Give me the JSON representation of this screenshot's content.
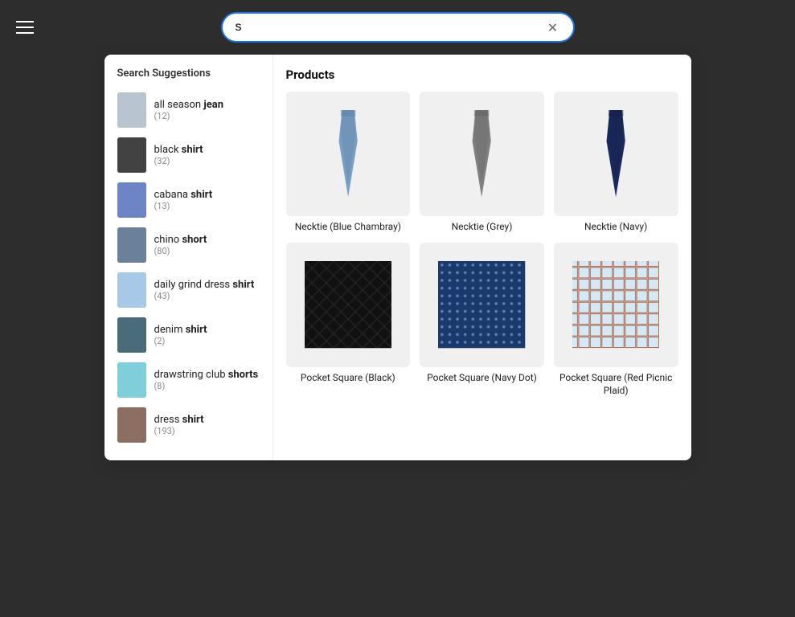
{
  "header": {
    "menu_aria": "menu",
    "search_value": "s",
    "clear_aria": "clear search"
  },
  "suggestions": {
    "heading": "Search Suggestions",
    "items": [
      {
        "id": "all-season-jean",
        "name_prefix": "all season ",
        "name_bold": "jean",
        "count": 12,
        "thumb_color": "#b8c5d0",
        "label": "all season jean"
      },
      {
        "id": "black-shirt",
        "name_prefix": "black ",
        "name_bold": "shirt",
        "count": 32,
        "thumb_color": "#424242",
        "label": "black shirt"
      },
      {
        "id": "cabana-shirt",
        "name_prefix": "cabana ",
        "name_bold": "shirt",
        "count": 13,
        "thumb_color": "#6d85c4",
        "label": "cabana shirt"
      },
      {
        "id": "chino-short",
        "name_prefix": "chino ",
        "name_bold": "short",
        "count": 80,
        "thumb_color": "#6b8099",
        "label": "chino short"
      },
      {
        "id": "daily-grind-dress-shirt",
        "name_prefix": "daily grind dress ",
        "name_bold": "shirt",
        "count": 43,
        "thumb_color": "#a8c8e8",
        "label": "daily grind dress shirt"
      },
      {
        "id": "denim-shirt",
        "name_prefix": "denim ",
        "name_bold": "shirt",
        "count": 2,
        "thumb_color": "#4a6b7a",
        "label": "denim shirt"
      },
      {
        "id": "drawstring-club-shorts",
        "name_prefix": "drawstring club ",
        "name_bold": "shorts",
        "count": 8,
        "thumb_color": "#7ecfd9",
        "label": "drawstring club shorts"
      },
      {
        "id": "dress-shirt",
        "name_prefix": "dress ",
        "name_bold": "shirt",
        "count": 193,
        "thumb_color": "#8d6e63",
        "label": "dress shirt"
      }
    ]
  },
  "products": {
    "heading": "Products",
    "items": [
      {
        "id": "necktie-blue-chambray",
        "name": "Necktie (Blue Chambray)",
        "image_type": "necktie-blue",
        "color_main": "#7b9fc4",
        "color_detail": "#5a7fa0"
      },
      {
        "id": "necktie-grey",
        "name": "Necktie (Grey)",
        "image_type": "necktie-grey",
        "color_main": "#808080",
        "color_detail": "#606060"
      },
      {
        "id": "necktie-navy",
        "name": "Necktie (Navy)",
        "image_type": "necktie-navy",
        "color_main": "#1a2a5e",
        "color_detail": "#131e42"
      },
      {
        "id": "pocket-square-black",
        "name": "Pocket Square (Black)",
        "image_type": "pocket-square-black",
        "color_main": "#1a1a1a",
        "color_detail": "#333333"
      },
      {
        "id": "pocket-square-navy-dot",
        "name": "Pocket Square (Navy Dot)",
        "image_type": "pocket-square-navy-dot",
        "color_main": "#1a3a6e",
        "color_detail": "#7090c0"
      },
      {
        "id": "pocket-square-red-picnic-plaid",
        "name": "Pocket Square (Red Picnic Plaid)",
        "image_type": "pocket-square-plaid",
        "color_main": "#d4e8f5",
        "color_detail": "#c0603a"
      }
    ]
  }
}
